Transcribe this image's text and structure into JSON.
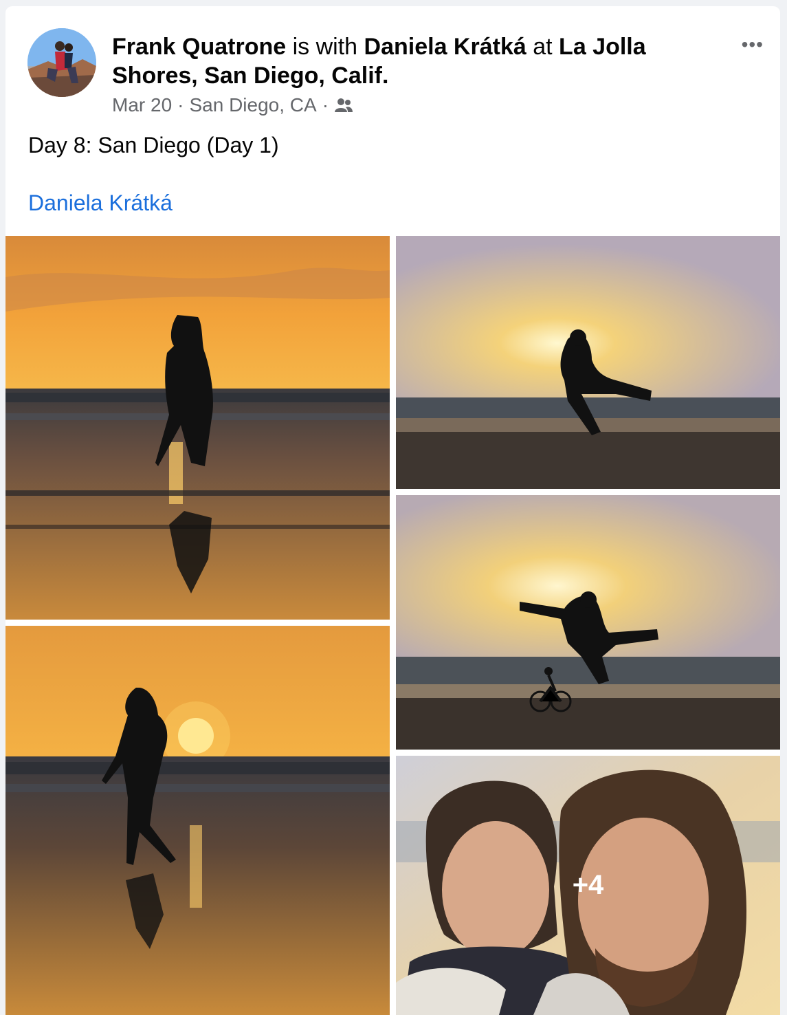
{
  "post": {
    "author": "Frank Quatrone",
    "with_text": "is with",
    "tagged": "Daniela Krátká",
    "at_text": "at",
    "location": "La Jolla Shores, San Diego, Calif.",
    "date": "Mar 20",
    "separator": "·",
    "place": "San Diego, CA",
    "audience_icon": "friends-icon",
    "more_label": "•••",
    "body": "Day 8: San Diego (Day 1)",
    "tag_link": "Daniela Krátká"
  },
  "photos": {
    "more_count": "+4"
  },
  "colors": {
    "link": "#1b6fdc",
    "meta": "#65676b",
    "sunset_orange": "#f2a23a"
  }
}
